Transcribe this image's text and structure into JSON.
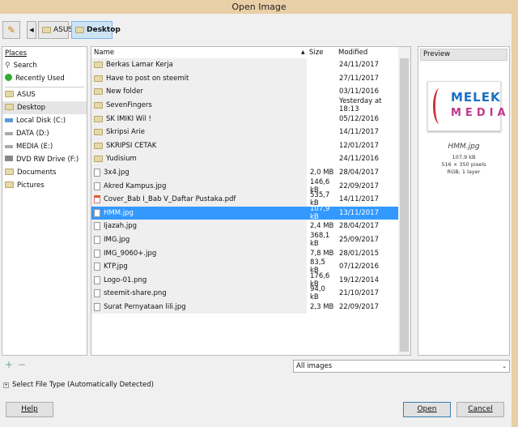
{
  "window": {
    "title": "Open Image"
  },
  "toolbar": {
    "path": [
      "ASUS",
      "Desktop"
    ],
    "active": "Desktop"
  },
  "places": {
    "header": "Places",
    "items": [
      {
        "label": "Search",
        "icon": "search-icon"
      },
      {
        "label": "Recently Used",
        "icon": "recent-icon"
      },
      {
        "label": "ASUS",
        "icon": "folder-icon"
      },
      {
        "label": "Desktop",
        "icon": "folder-icon",
        "selected": true
      },
      {
        "label": "Local Disk (C:)",
        "icon": "disk-icon"
      },
      {
        "label": "DATA (D:)",
        "icon": "drive-icon"
      },
      {
        "label": "MEDIA (E:)",
        "icon": "drive-icon"
      },
      {
        "label": "DVD RW Drive (F:)",
        "icon": "dvd-icon"
      },
      {
        "label": "Documents",
        "icon": "folder-icon"
      },
      {
        "label": "Pictures",
        "icon": "folder-icon"
      }
    ]
  },
  "files": {
    "columns": {
      "name": "Name",
      "size": "Size",
      "modified": "Modified"
    },
    "rows": [
      {
        "name": "Berkas Lamar Kerja",
        "size": "",
        "modified": "24/11/2017",
        "type": "folder"
      },
      {
        "name": "Have to post on steemit",
        "size": "",
        "modified": "27/11/2017",
        "type": "folder"
      },
      {
        "name": "New folder",
        "size": "",
        "modified": "03/11/2016",
        "type": "folder"
      },
      {
        "name": "SevenFingers",
        "size": "",
        "modified": "Yesterday at 18:13",
        "type": "folder"
      },
      {
        "name": "SK IMIKI Wil !",
        "size": "",
        "modified": "05/12/2016",
        "type": "folder"
      },
      {
        "name": "Skripsi Arie",
        "size": "",
        "modified": "14/11/2017",
        "type": "folder"
      },
      {
        "name": "SKRIPSI CETAK",
        "size": "",
        "modified": "12/01/2017",
        "type": "folder"
      },
      {
        "name": "Yudisium",
        "size": "",
        "modified": "24/11/2016",
        "type": "folder"
      },
      {
        "name": "3x4.jpg",
        "size": "2,0 MB",
        "modified": "28/04/2017",
        "type": "file"
      },
      {
        "name": "Akred Kampus.jpg",
        "size": "146,6 kB",
        "modified": "22/09/2017",
        "type": "file"
      },
      {
        "name": "Cover_Bab I_Bab V_Daftar Pustaka.pdf",
        "size": "535,7 kB",
        "modified": "14/11/2017",
        "type": "pdf"
      },
      {
        "name": "HMM.jpg",
        "size": "107,9 kB",
        "modified": "13/11/2017",
        "type": "file",
        "selected": true
      },
      {
        "name": "Ijazah.jpg",
        "size": "2,4 MB",
        "modified": "28/04/2017",
        "type": "file"
      },
      {
        "name": "IMG.jpg",
        "size": "368,1 kB",
        "modified": "25/09/2017",
        "type": "file"
      },
      {
        "name": "IMG_9060+.jpg",
        "size": "7,8 MB",
        "modified": "28/01/2015",
        "type": "file"
      },
      {
        "name": "KTP.jpg",
        "size": "83,5 kB",
        "modified": "07/12/2016",
        "type": "file"
      },
      {
        "name": "Logo-01.png",
        "size": "176,6 kB",
        "modified": "19/12/2014",
        "type": "file"
      },
      {
        "name": "steemit-share.png",
        "size": "94,0 kB",
        "modified": "21/10/2017",
        "type": "file"
      },
      {
        "name": "Surat Pernyataan lili.jpg",
        "size": "2,3 MB",
        "modified": "22/09/2017",
        "type": "file"
      }
    ]
  },
  "preview": {
    "header": "Preview",
    "logo_text": [
      "MELEK",
      "MEDIA"
    ],
    "filename": "HMM.jpg",
    "size": "107,9 kB",
    "dimensions": "516 × 350 pixels",
    "mode": "RGB, 1 layer"
  },
  "filter": {
    "selected": "All images"
  },
  "file_type": {
    "label": "Select File Type (Automatically Detected)"
  },
  "buttons": {
    "help": "Help",
    "open": "Open",
    "cancel": "Cancel"
  },
  "colors": {
    "titlebar": "#e9cfa6",
    "selection": "#3399ff"
  }
}
